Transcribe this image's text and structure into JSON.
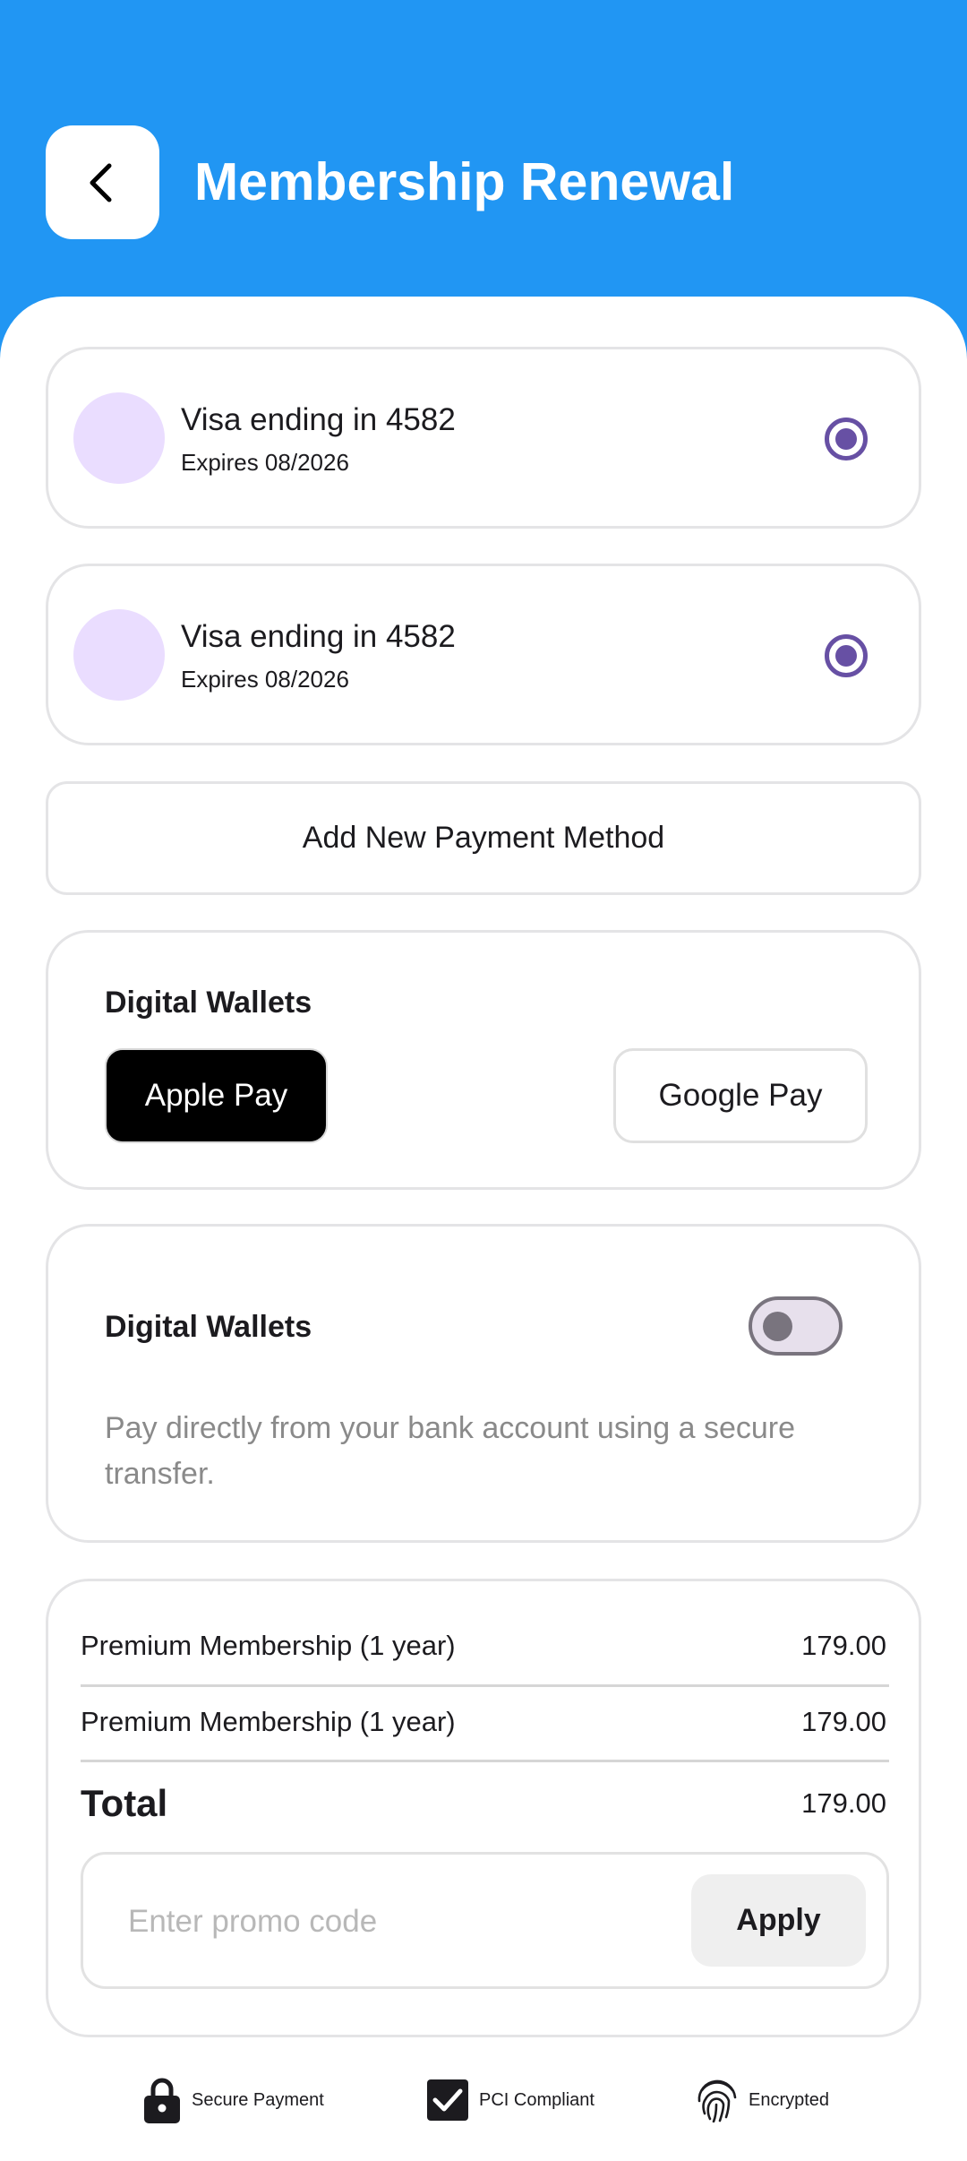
{
  "header": {
    "title": "Membership Renewal",
    "back_icon": "chevron-left-icon"
  },
  "payment_methods": [
    {
      "title": "Visa ending in 4582",
      "subtitle": "Expires 08/2026",
      "selected": true
    },
    {
      "title": "Visa ending in 4582",
      "subtitle": "Expires 08/2026",
      "selected": true
    }
  ],
  "add_payment_label": "Add New Payment Method",
  "wallets": {
    "title": "Digital Wallets",
    "apple_pay": "Apple Pay",
    "google_pay": "Google Pay"
  },
  "bank_transfer": {
    "title": "Digital Wallets",
    "enabled": false,
    "description": "Pay directly from your bank account using a secure transfer."
  },
  "summary": {
    "items": [
      {
        "label": "Premium Membership (1 year)",
        "amount": "179.00"
      },
      {
        "label": "Premium Membership (1 year)",
        "amount": "179.00"
      }
    ],
    "total_label": "Total",
    "total_amount": "179.00",
    "promo_placeholder": "Enter promo code",
    "apply_label": "Apply"
  },
  "trust_badges": [
    {
      "icon": "lock-icon",
      "label": "Secure Payment"
    },
    {
      "icon": "checkbox-icon",
      "label": "PCI Compliant"
    },
    {
      "icon": "fingerprint-icon",
      "label": "Encrypted"
    }
  ],
  "colors": {
    "header": "#2196F3",
    "accent": "#6750A4",
    "avatar": "#EADDFF"
  }
}
